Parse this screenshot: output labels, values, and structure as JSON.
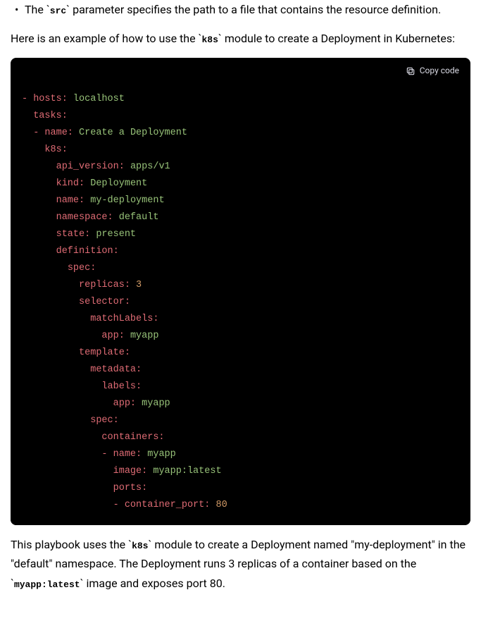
{
  "bullet": {
    "pre": "The ",
    "code": "src",
    "post": " parameter specifies the path to a file that contains the resource definition."
  },
  "intro": {
    "pre": "Here is an example of how to use the ",
    "code": "k8s",
    "post": " module to create a Deployment in Kubernetes:"
  },
  "copy_label": "Copy code",
  "code_lines": [
    [
      [
        "dash",
        "- "
      ],
      [
        "key",
        "hosts:"
      ],
      [
        "plain",
        " "
      ],
      [
        "str",
        "localhost"
      ]
    ],
    [
      [
        "plain",
        "  "
      ],
      [
        "key",
        "tasks:"
      ]
    ],
    [
      [
        "plain",
        "  "
      ],
      [
        "dash",
        "- "
      ],
      [
        "key",
        "name:"
      ],
      [
        "plain",
        " "
      ],
      [
        "str",
        "Create a Deployment"
      ]
    ],
    [
      [
        "plain",
        "    "
      ],
      [
        "key",
        "k8s:"
      ]
    ],
    [
      [
        "plain",
        "      "
      ],
      [
        "key",
        "api_version:"
      ],
      [
        "plain",
        " "
      ],
      [
        "str",
        "apps/v1"
      ]
    ],
    [
      [
        "plain",
        "      "
      ],
      [
        "key",
        "kind:"
      ],
      [
        "plain",
        " "
      ],
      [
        "str",
        "Deployment"
      ]
    ],
    [
      [
        "plain",
        "      "
      ],
      [
        "key",
        "name:"
      ],
      [
        "plain",
        " "
      ],
      [
        "str",
        "my-deployment"
      ]
    ],
    [
      [
        "plain",
        "      "
      ],
      [
        "key",
        "namespace:"
      ],
      [
        "plain",
        " "
      ],
      [
        "str",
        "default"
      ]
    ],
    [
      [
        "plain",
        "      "
      ],
      [
        "key",
        "state:"
      ],
      [
        "plain",
        " "
      ],
      [
        "str",
        "present"
      ]
    ],
    [
      [
        "plain",
        "      "
      ],
      [
        "key",
        "definition:"
      ]
    ],
    [
      [
        "plain",
        "        "
      ],
      [
        "key",
        "spec:"
      ]
    ],
    [
      [
        "plain",
        "          "
      ],
      [
        "key",
        "replicas:"
      ],
      [
        "plain",
        " "
      ],
      [
        "num",
        "3"
      ]
    ],
    [
      [
        "plain",
        "          "
      ],
      [
        "key",
        "selector:"
      ]
    ],
    [
      [
        "plain",
        "            "
      ],
      [
        "key",
        "matchLabels:"
      ]
    ],
    [
      [
        "plain",
        "              "
      ],
      [
        "key",
        "app:"
      ],
      [
        "plain",
        " "
      ],
      [
        "str",
        "myapp"
      ]
    ],
    [
      [
        "plain",
        "          "
      ],
      [
        "key",
        "template:"
      ]
    ],
    [
      [
        "plain",
        "            "
      ],
      [
        "key",
        "metadata:"
      ]
    ],
    [
      [
        "plain",
        "              "
      ],
      [
        "key",
        "labels:"
      ]
    ],
    [
      [
        "plain",
        "                "
      ],
      [
        "key",
        "app:"
      ],
      [
        "plain",
        " "
      ],
      [
        "str",
        "myapp"
      ]
    ],
    [
      [
        "plain",
        "            "
      ],
      [
        "key",
        "spec:"
      ]
    ],
    [
      [
        "plain",
        "              "
      ],
      [
        "key",
        "containers:"
      ]
    ],
    [
      [
        "plain",
        "              "
      ],
      [
        "dash",
        "- "
      ],
      [
        "key",
        "name:"
      ],
      [
        "plain",
        " "
      ],
      [
        "str",
        "myapp"
      ]
    ],
    [
      [
        "plain",
        "                "
      ],
      [
        "key",
        "image:"
      ],
      [
        "plain",
        " "
      ],
      [
        "str",
        "myapp:latest"
      ]
    ],
    [
      [
        "plain",
        "                "
      ],
      [
        "key",
        "ports:"
      ]
    ],
    [
      [
        "plain",
        "                "
      ],
      [
        "dash",
        "- "
      ],
      [
        "key",
        "container_port:"
      ],
      [
        "plain",
        " "
      ],
      [
        "num",
        "80"
      ]
    ]
  ],
  "outro": {
    "pre": "This playbook uses the ",
    "code1": "k8s",
    "mid": " module to create a Deployment named \"my-deployment\" in the \"default\" namespace. The Deployment runs 3 replicas of a container based on the ",
    "code2": "myapp:latest",
    "post": " image and exposes port 80."
  }
}
